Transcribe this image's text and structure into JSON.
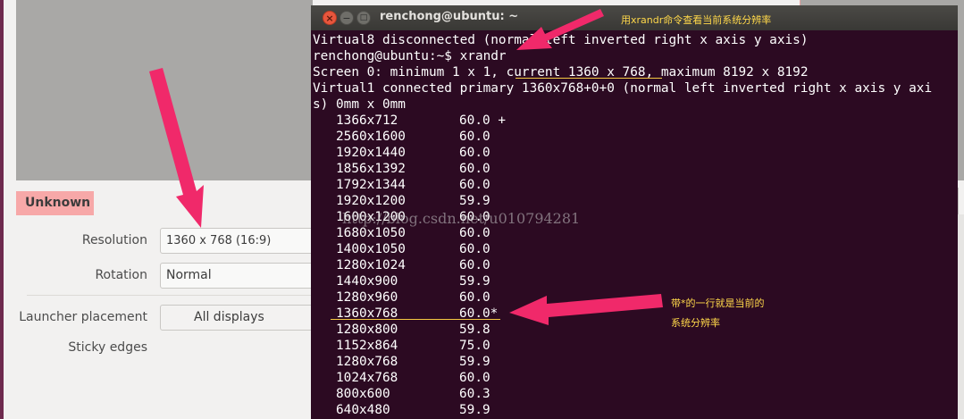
{
  "display_settings": {
    "monitor_name": "Unknown",
    "resolution": {
      "label": "Resolution",
      "value": "1360 x 768 (16:9)"
    },
    "rotation": {
      "label": "Rotation",
      "value": "Normal"
    },
    "launcher_placement": {
      "label": "Launcher placement",
      "value": "All displays"
    },
    "sticky_edges": {
      "label": "Sticky edges"
    }
  },
  "terminal": {
    "title": "renchong@ubuntu: ~",
    "lines": [
      "Virtual8 disconnected (normal left inverted right x axis y axis)",
      "renchong@ubuntu:~$ xrandr",
      "Screen 0: minimum 1 x 1, current 1360 x 768, maximum 8192 x 8192",
      "Virtual1 connected primary 1360x768+0+0 (normal left inverted right x axis y axi",
      "s) 0mm x 0mm"
    ],
    "modes": [
      {
        "resolution": "1366x712",
        "rate": "60.0 +"
      },
      {
        "resolution": "2560x1600",
        "rate": "60.0"
      },
      {
        "resolution": "1920x1440",
        "rate": "60.0"
      },
      {
        "resolution": "1856x1392",
        "rate": "60.0"
      },
      {
        "resolution": "1792x1344",
        "rate": "60.0"
      },
      {
        "resolution": "1920x1200",
        "rate": "59.9"
      },
      {
        "resolution": "1600x1200",
        "rate": "60.0"
      },
      {
        "resolution": "1680x1050",
        "rate": "60.0"
      },
      {
        "resolution": "1400x1050",
        "rate": "60.0"
      },
      {
        "resolution": "1280x1024",
        "rate": "60.0"
      },
      {
        "resolution": "1440x900",
        "rate": "59.9"
      },
      {
        "resolution": "1280x960",
        "rate": "60.0"
      },
      {
        "resolution": "1360x768",
        "rate": "60.0*"
      },
      {
        "resolution": "1280x800",
        "rate": "59.8"
      },
      {
        "resolution": "1152x864",
        "rate": "75.0"
      },
      {
        "resolution": "1280x768",
        "rate": "59.9"
      },
      {
        "resolution": "1024x768",
        "rate": "60.0"
      },
      {
        "resolution": "800x600",
        "rate": "60.3"
      },
      {
        "resolution": "640x480",
        "rate": "59.9"
      }
    ]
  },
  "annotations": {
    "top_note": "用xrandr命令查看当前系统分辨率",
    "right_note_line1": "带*的一行就是当前的",
    "right_note_line2": "系统分辨率",
    "watermark": "http://blog.csdn.net/u010794281"
  },
  "colors": {
    "terminal_bg": "#2c0a22",
    "annotation_arrow": "#f0296a",
    "annotation_text": "#ffd84a",
    "badge": "#f7a8a8"
  }
}
